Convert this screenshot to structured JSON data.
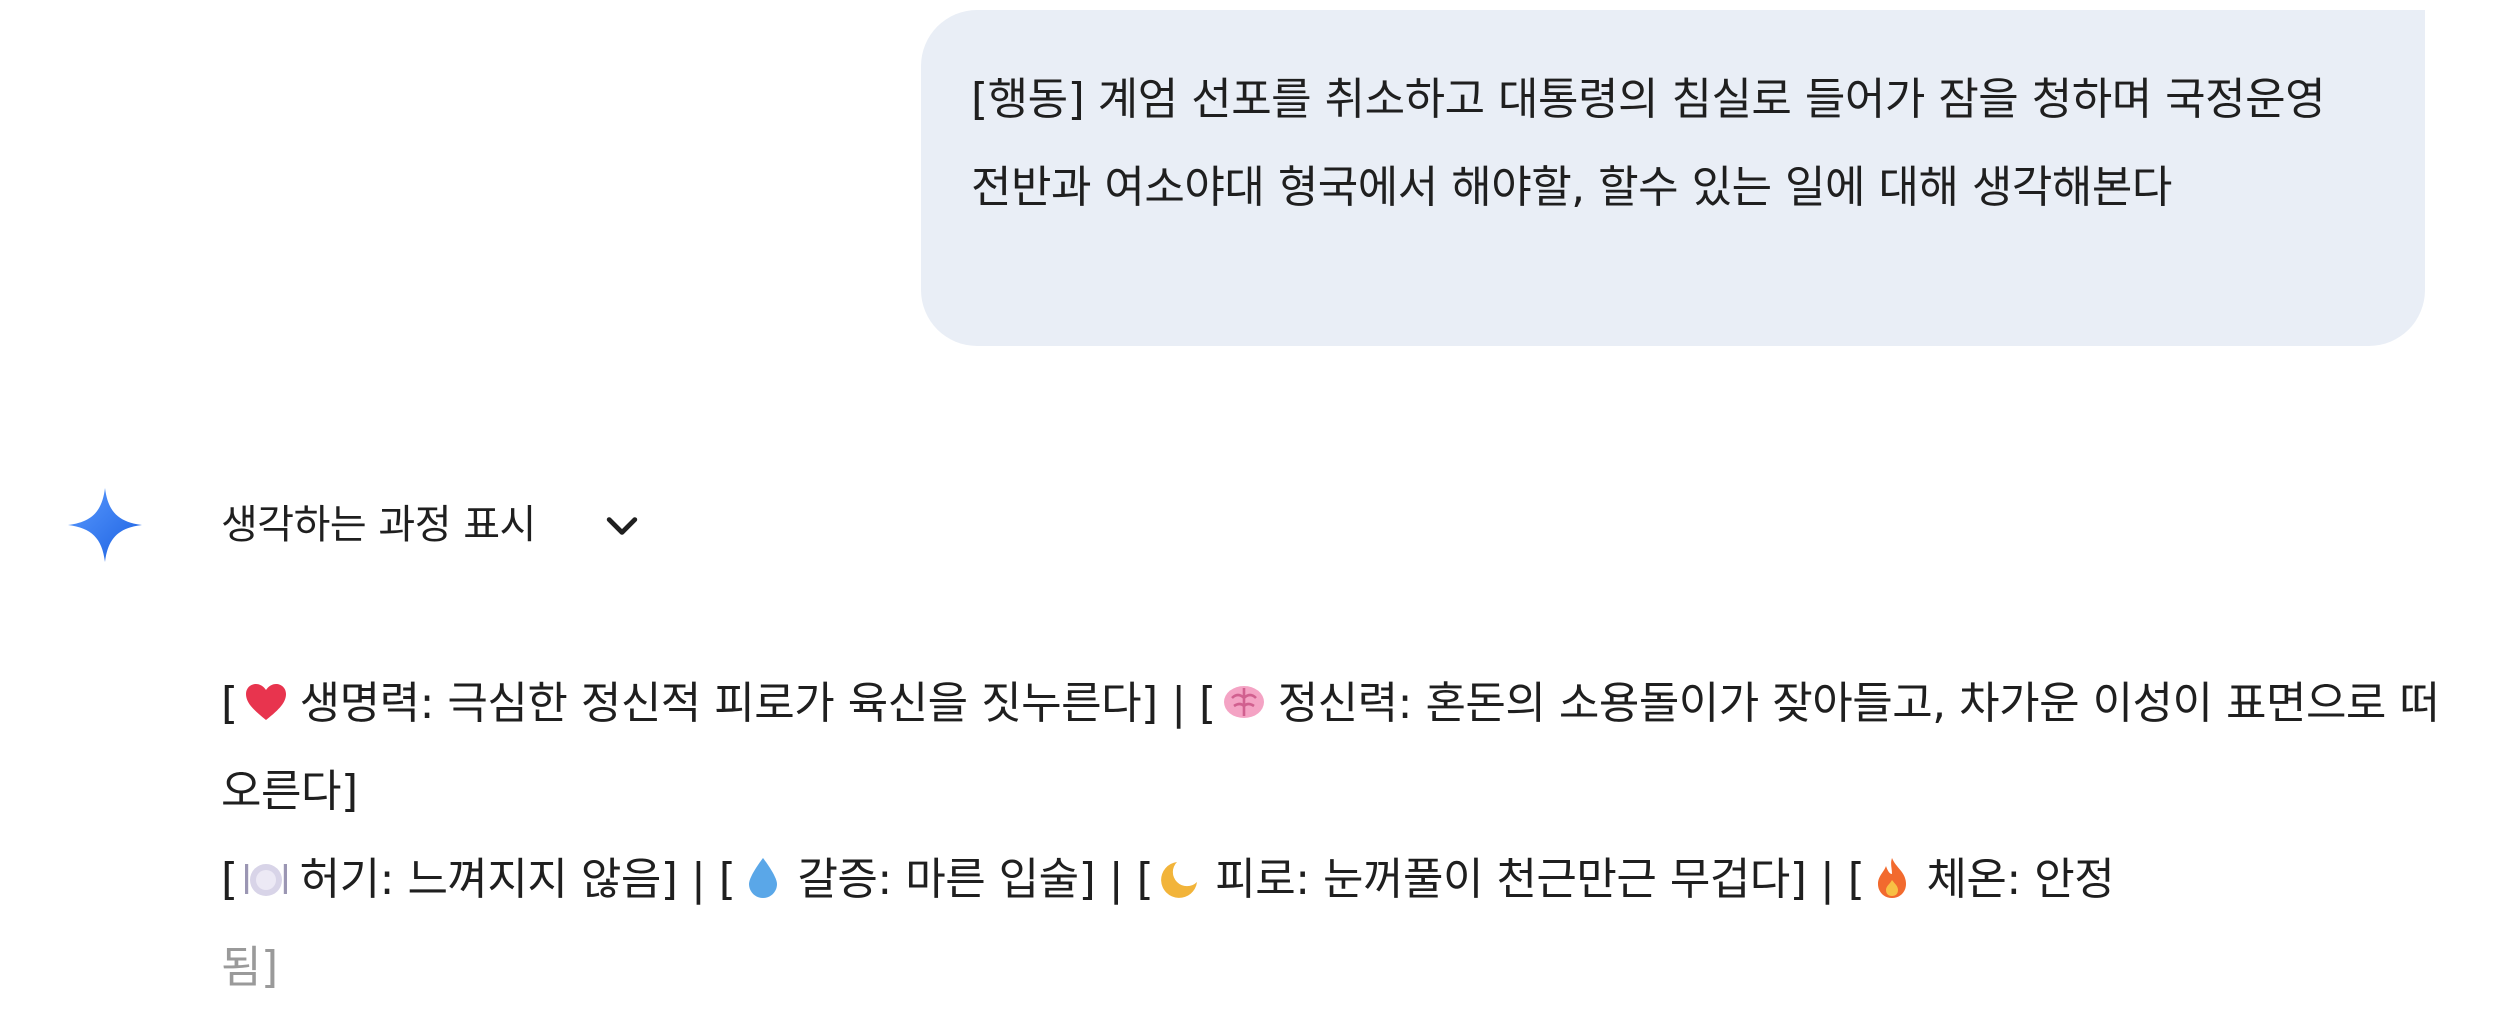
{
  "user_message": {
    "text": "[행동] 계엄 선포를 취소하고 대통령의 침실로 들어가 잠을 청하며 국정운영 전반과 여소야대 형국에서 해야할, 할수 있는 일에 대해 생각해본다"
  },
  "assistant": {
    "logo_icon": "gemini-sparkle-icon",
    "thinking_toggle_label": "생각하는 과정 표시",
    "toggle_icon": "chevron-down-icon",
    "status_line_1": {
      "vitality_open": "[",
      "vitality_icon": "heart-icon",
      "vitality_text": "생명력: 극심한 정신적 피로가 육신을 짓누른다]",
      "separator": " | ",
      "mental_open": "[",
      "mental_icon": "brain-icon",
      "mental_text": "정신력: 혼돈의 소용돌이가 잦아들고, 차가운 이성이 표면으로 떠오른다]"
    },
    "status_line_2": {
      "hunger_open": "[",
      "hunger_icon": "plate-icon",
      "hunger_text": "허기: 느껴지지 않음]",
      "thirst_open": "[",
      "thirst_icon": "droplet-icon",
      "thirst_text": "갈증: 마른 입술]",
      "fatigue_open": "[",
      "fatigue_icon": "crescent-moon-icon",
      "fatigue_text": "피로: 눈꺼풀이 천근만근 무겁다]",
      "temp_open": "[",
      "temp_icon": "fire-icon",
      "temp_text_main": "체온: 안정",
      "temp_text_faded": "됨]",
      "separator": " | "
    }
  },
  "colors": {
    "user_bubble_bg": "#e9eef6",
    "text": "#1f1f1f",
    "faded_text": "#9a9a9a",
    "sparkle_gradient": [
      "#4f8ff7",
      "#1a66e8"
    ]
  }
}
